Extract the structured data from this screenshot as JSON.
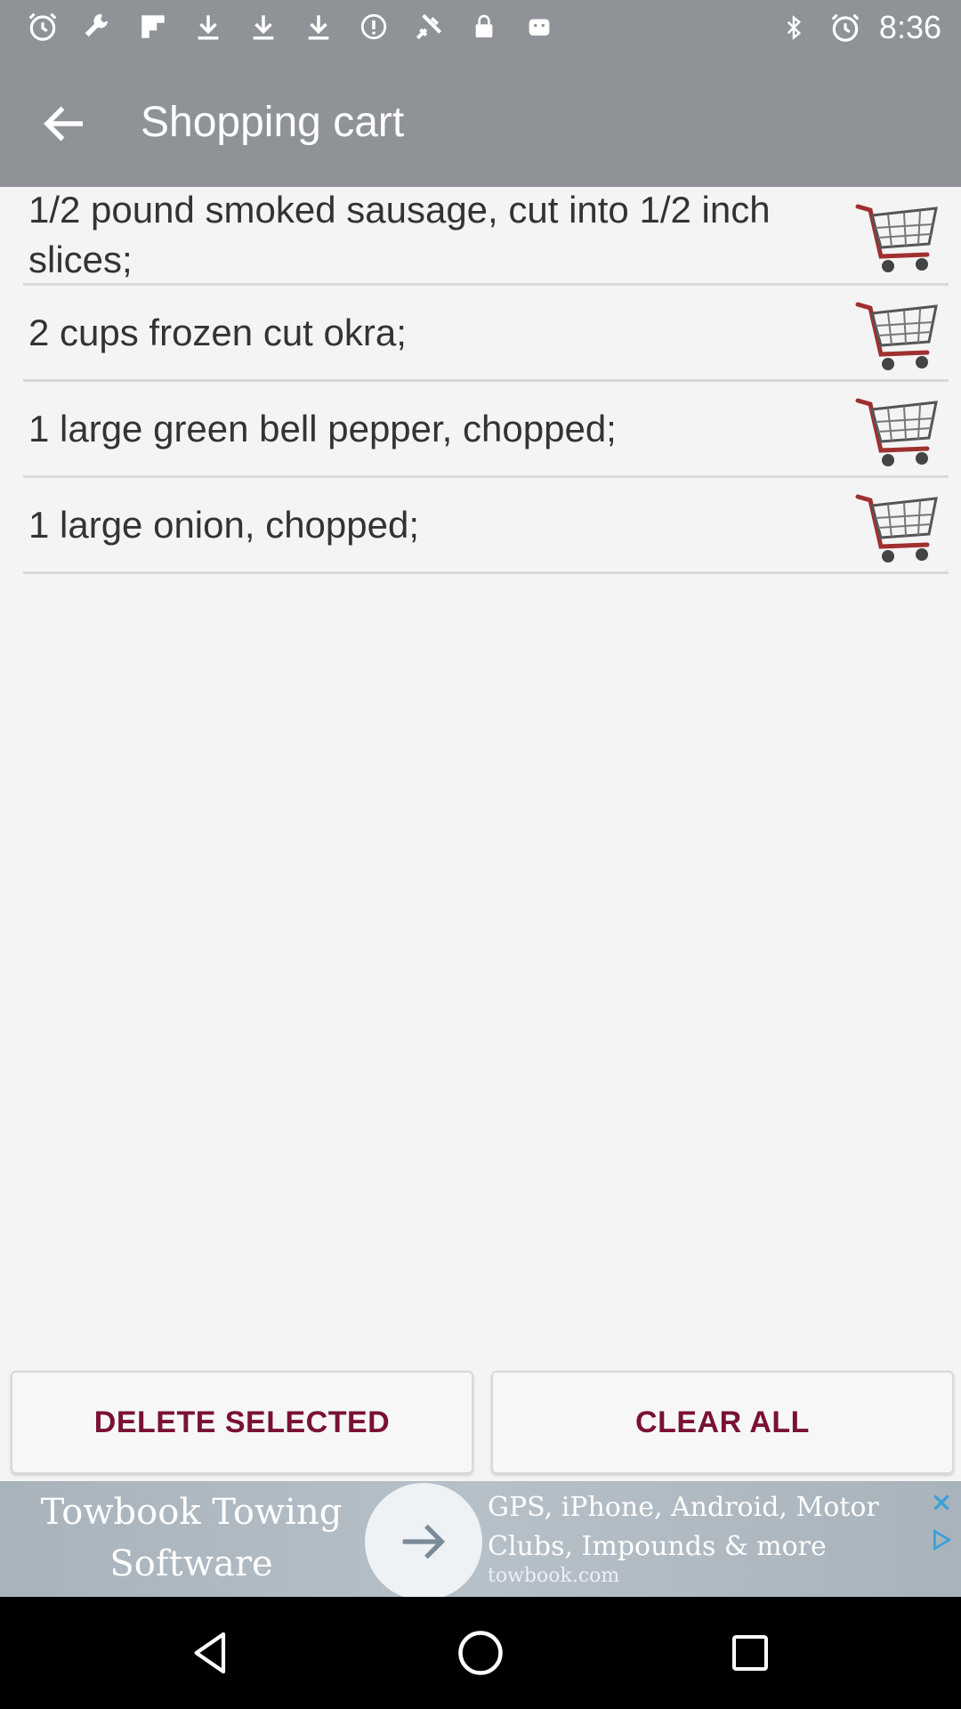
{
  "status_bar": {
    "time": "8:36",
    "left_icons": [
      "alarm-icon",
      "wrench-icon",
      "flipboard-icon",
      "download-icon",
      "download-icon",
      "download-icon",
      "info-icon",
      "fake-gps-icon",
      "lock-icon",
      "android-icon"
    ],
    "right_icons": [
      "bluetooth-icon",
      "alarm-icon"
    ]
  },
  "app_bar": {
    "title": "Shopping cart"
  },
  "items": [
    {
      "text": "1/2 pound smoked sausage, cut into 1/2 inch slices;"
    },
    {
      "text": "2 cups frozen cut okra;"
    },
    {
      "text": "1 large green bell pepper, chopped;"
    },
    {
      "text": "1 large onion, chopped;"
    }
  ],
  "buttons": {
    "delete_selected": "DELETE SELECTED",
    "clear_all": "CLEAR ALL"
  },
  "ad": {
    "headline": "Towbook Towing Software",
    "body": "GPS, iPhone, Android, Motor Clubs, Impounds & more",
    "url": "towbook.com"
  },
  "colors": {
    "app_bar": "#8f9397",
    "button_text": "#7a1134",
    "background": "#f4f4f4"
  }
}
